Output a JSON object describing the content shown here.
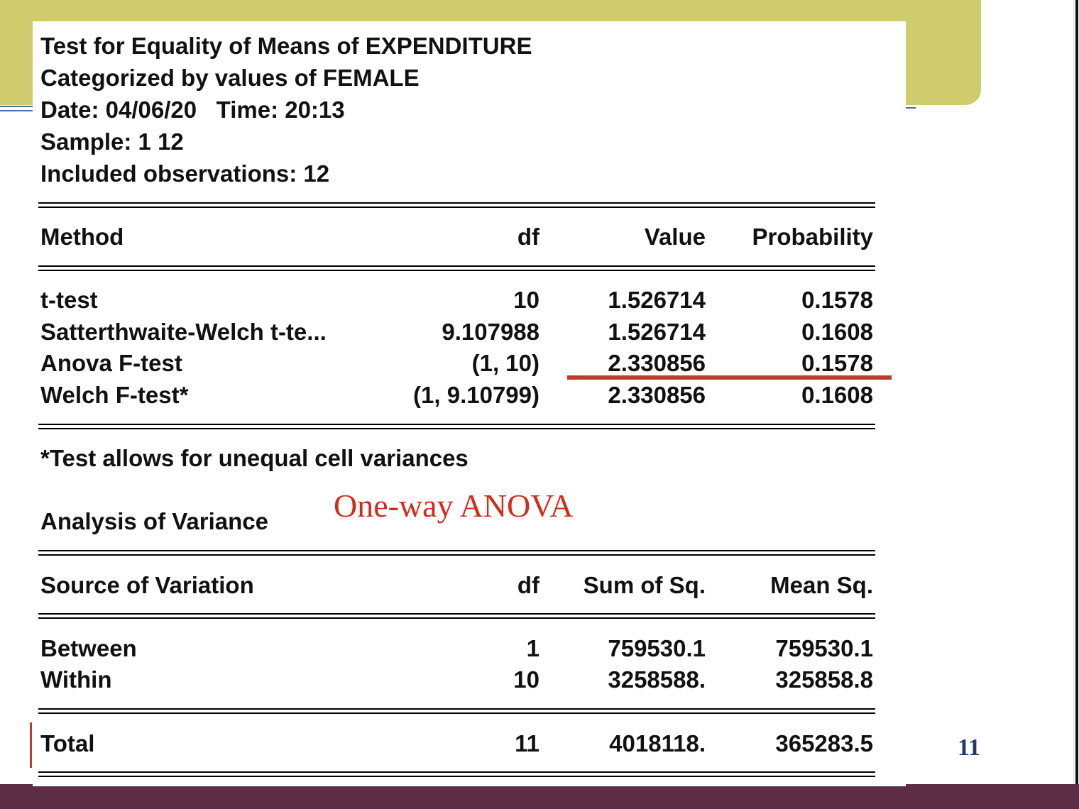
{
  "header": {
    "line1": "Test for Equality of Means of EXPENDITURE",
    "line2": "Categorized by values of FEMALE",
    "line3": "Date: 04/06/20   Time: 20:13",
    "line4": "Sample: 1 12",
    "line5": "Included observations: 12"
  },
  "tests_table": {
    "columns": [
      "Method",
      "df",
      "Value",
      "Probability"
    ],
    "rows": [
      {
        "method": "t-test",
        "df": "10",
        "value": "1.526714",
        "probability": "0.1578"
      },
      {
        "method": "Satterthwaite-Welch t-te...",
        "df": "9.107988",
        "value": "1.526714",
        "probability": "0.1608"
      },
      {
        "method": "Anova F-test",
        "df": "(1, 10)",
        "value": "2.330856",
        "probability": "0.1578"
      },
      {
        "method": "Welch F-test*",
        "df": "(1, 9.10799)",
        "value": "2.330856",
        "probability": "0.1608"
      }
    ],
    "footnote": "*Test allows for unequal cell variances"
  },
  "anova": {
    "section_title": "Analysis of Variance",
    "annotation": "One-way ANOVA",
    "columns": [
      "Source of Variation",
      "df",
      "Sum of Sq.",
      "Mean Sq."
    ],
    "rows": [
      {
        "source": "Between",
        "df": "1",
        "sum_sq": "759530.1",
        "mean_sq": "759530.1"
      },
      {
        "source": "Within",
        "df": "10",
        "sum_sq": "3258588.",
        "mean_sq": "325858.8"
      }
    ],
    "total": {
      "source": "Total",
      "df": "11",
      "sum_sq": "4018118.",
      "mean_sq": "365283.5"
    }
  },
  "slide": {
    "page_number": "11",
    "colors": {
      "banner": "#cfcc6e",
      "bottom_bar": "#5c2d45",
      "highlight": "#c0392b",
      "annotation": "#d22b1c",
      "page_number": "#1f3a6b"
    }
  }
}
